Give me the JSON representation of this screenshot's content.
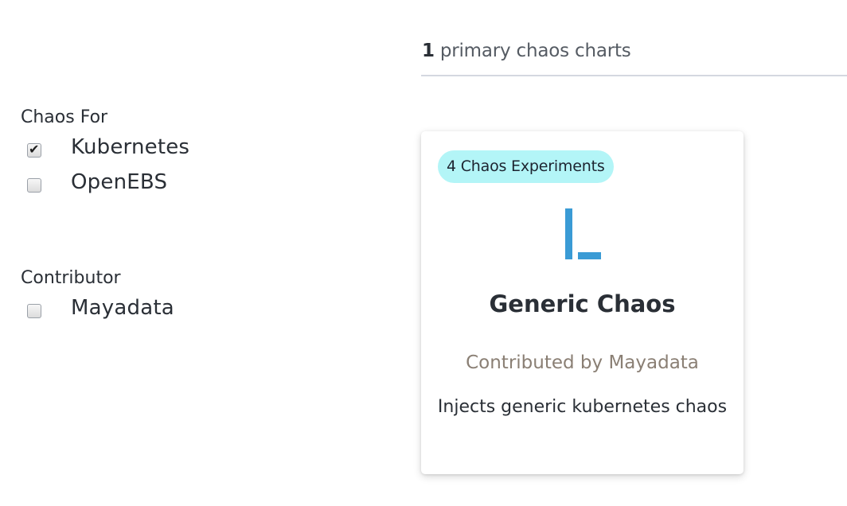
{
  "results": {
    "count": "1",
    "label": "primary chaos charts"
  },
  "filters": {
    "chaos_for": {
      "title": "Chaos For",
      "options": [
        {
          "label": "Kubernetes",
          "checked": true
        },
        {
          "label": "OpenEBS",
          "checked": false
        }
      ]
    },
    "contributor": {
      "title": "Contributor",
      "options": [
        {
          "label": "Mayadata",
          "checked": false
        }
      ]
    }
  },
  "checkmark_glyph": "✔",
  "card": {
    "badge": "4 Chaos Experiments",
    "badge_color": "#b3f5f7",
    "logo_icon": "generic-chaos-logo-icon",
    "logo_color": "#3a9bd5",
    "title": "Generic Chaos",
    "contributor": "Contributed by Mayadata",
    "description": "Injects generic kubernetes chaos"
  }
}
